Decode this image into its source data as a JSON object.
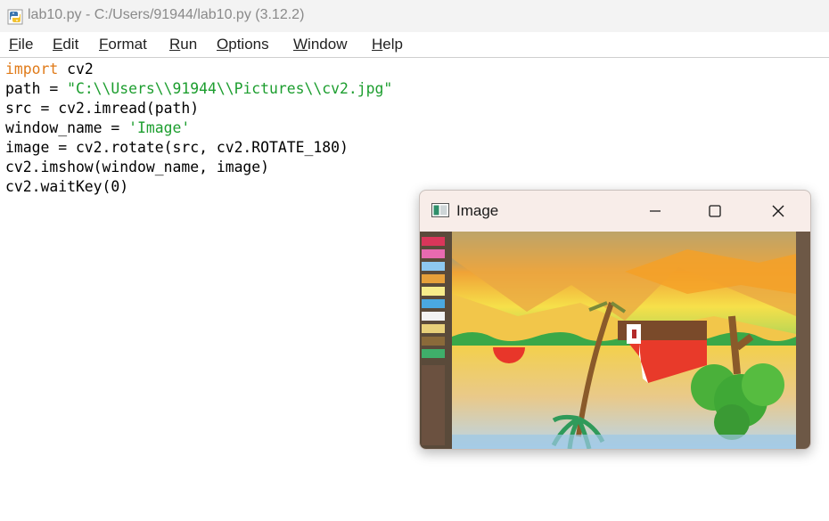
{
  "window": {
    "title": "lab10.py - C:/Users/91944/lab10.py (3.12.2)"
  },
  "menu": {
    "items": [
      "File",
      "Edit",
      "Format",
      "Run",
      "Options",
      "Window",
      "Help"
    ]
  },
  "editor": {
    "lines": [
      [
        {
          "t": "import",
          "c": "kw"
        },
        {
          "t": " cv2",
          "c": ""
        }
      ],
      [
        {
          "t": "path = ",
          "c": ""
        },
        {
          "t": "\"C:\\\\Users\\\\91944\\\\Pictures\\\\cv2.jpg\"",
          "c": "str"
        }
      ],
      [
        {
          "t": "src = cv2.imread(path)",
          "c": ""
        }
      ],
      [
        {
          "t": "window_name = ",
          "c": ""
        },
        {
          "t": "'Image'",
          "c": "str"
        }
      ],
      [
        {
          "t": "image = cv2.rotate(src, cv2.ROTATE_180)",
          "c": ""
        }
      ],
      [
        {
          "t": "cv2.imshow(window_name, image)",
          "c": ""
        }
      ],
      [
        {
          "t": "cv2.waitKey(0)",
          "c": ""
        }
      ]
    ]
  },
  "image_window": {
    "title": "Image",
    "icons": {
      "app": "opencv-window-icon",
      "minimize": "minimize-icon",
      "maximize": "maximize-icon",
      "close": "close-icon"
    }
  },
  "colors": {
    "keyword": "#e07b1a",
    "string": "#1d9e2f",
    "titlebar": "#f3f3f3",
    "image_window_titlebar": "#f8ede9"
  }
}
